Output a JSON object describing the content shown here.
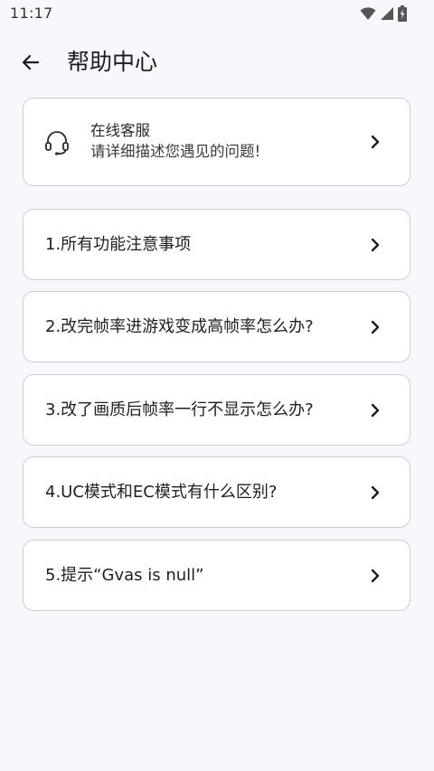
{
  "status_bar": {
    "time": "11:17",
    "icons": [
      "wifi-icon",
      "signal-icon",
      "battery-charging-icon"
    ]
  },
  "header": {
    "back_icon": "arrow-left-icon",
    "title": "帮助中心"
  },
  "service": {
    "icon": "headset-icon",
    "title": "在线客服",
    "subtitle": "请详细描述您遇见的问题!",
    "chevron_icon": "chevron-right-icon"
  },
  "faq": {
    "chevron_icon": "chevron-right-icon",
    "items": [
      {
        "label": "1.所有功能注意事项"
      },
      {
        "label": "2.改完帧率进游戏变成高帧率怎么办?"
      },
      {
        "label": "3.改了画质后帧率一行不显示怎么办?"
      },
      {
        "label": "4.UC模式和EC模式有什么区别?"
      },
      {
        "label": "5.提示“Gvas is null”"
      }
    ]
  },
  "colors": {
    "background": "#f8f7fb",
    "card": "#ffffff",
    "border": "#cfcdd4",
    "text": "#1c1b1f"
  }
}
